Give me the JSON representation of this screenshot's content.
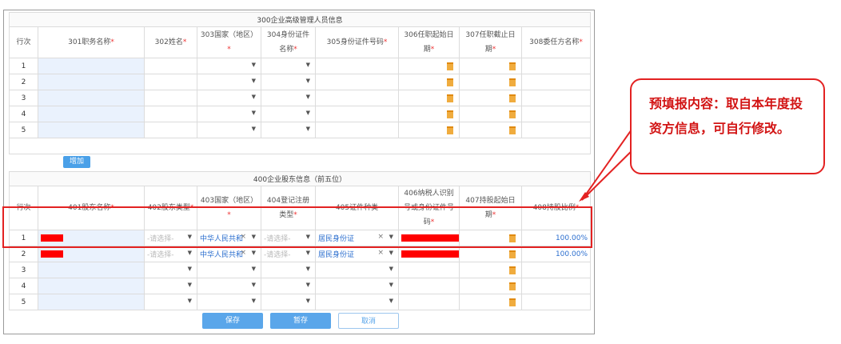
{
  "section300": {
    "title": "300企业高级管理人员信息",
    "headers": [
      "行次",
      "301职务名称",
      "302姓名",
      "303国家（地区）",
      "304身份证件名称",
      "305身份证件号码",
      "306任职起始日期",
      "307任职截止日期",
      "308委任方名称"
    ],
    "required": [
      false,
      true,
      true,
      true,
      true,
      true,
      true,
      true,
      true
    ],
    "rows": [
      "1",
      "2",
      "3",
      "4",
      "5"
    ],
    "add_label": "增加"
  },
  "section400": {
    "title": "400企业股东信息（前五位）",
    "headers": [
      "行次",
      "401股东名称",
      "402股东类型",
      "403国家（地区）",
      "404登记注册类型",
      "405证件种类",
      "406纳税人识别号或身份证件号码",
      "407持股起始日期",
      "408持股比例"
    ],
    "required": [
      false,
      true,
      true,
      true,
      true,
      false,
      true,
      true,
      true
    ],
    "select_placeholder": "-请选择-",
    "country_value": "中华人民共和",
    "id_type_value": "居民身份证",
    "filled_rows": [
      {
        "idx": "1",
        "ratio": "100.00%"
      },
      {
        "idx": "2",
        "ratio": "100.00%"
      }
    ],
    "empty_rows": [
      "3",
      "4",
      "5"
    ]
  },
  "buttons": {
    "save": "保存",
    "draft": "暂存",
    "cancel": "取消"
  },
  "callout": {
    "text": "预填报内容：取自本年度投资方信息，可自行修改。"
  },
  "colors": {
    "accent": "#e32222",
    "button": "#5aa6ea",
    "calendar": "#f0ac3e"
  }
}
